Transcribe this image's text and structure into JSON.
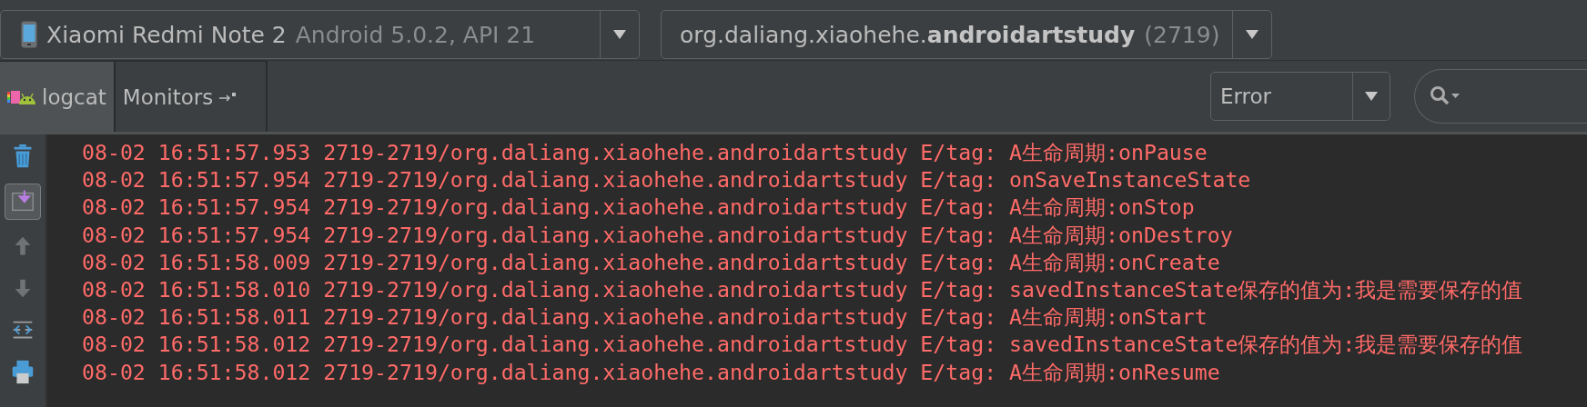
{
  "device_selector": {
    "name": "Xiaomi Redmi Note 2",
    "detail": "Android 5.0.2, API 21"
  },
  "process_selector": {
    "name": "org.daliang.xiaohehe.**androidartstudy**",
    "pid": "(2719)"
  },
  "tabs": [
    {
      "label": "logcat",
      "selected": true,
      "kind": "logcat"
    },
    {
      "label": "Monitors",
      "selected": false,
      "kind": "monitors"
    }
  ],
  "level_filter": {
    "value": "Error"
  },
  "tools": [
    {
      "kind": "clear",
      "selected": false
    },
    {
      "kind": "scroll_end",
      "selected": true
    },
    {
      "kind": "up",
      "selected": false
    },
    {
      "kind": "down",
      "selected": false
    },
    {
      "kind": "wrap",
      "selected": false
    },
    {
      "kind": "print",
      "selected": false
    }
  ],
  "log": [
    {
      "kind": "error",
      "text": "08-02 16:51:57.953 2719-2719/org.daliang.xiaohehe.androidartstudy E/tag: A生命周期:onPause"
    },
    {
      "kind": "error",
      "text": "08-02 16:51:57.954 2719-2719/org.daliang.xiaohehe.androidartstudy E/tag: onSaveInstanceState"
    },
    {
      "kind": "error",
      "text": "08-02 16:51:57.954 2719-2719/org.daliang.xiaohehe.androidartstudy E/tag: A生命周期:onStop"
    },
    {
      "kind": "error",
      "text": "08-02 16:51:57.954 2719-2719/org.daliang.xiaohehe.androidartstudy E/tag: A生命周期:onDestroy"
    },
    {
      "kind": "error",
      "text": "08-02 16:51:58.009 2719-2719/org.daliang.xiaohehe.androidartstudy E/tag: A生命周期:onCreate"
    },
    {
      "kind": "error",
      "text": "08-02 16:51:58.010 2719-2719/org.daliang.xiaohehe.androidartstudy E/tag: savedInstanceState保存的值为:我是需要保存的值"
    },
    {
      "kind": "error",
      "text": "08-02 16:51:58.011 2719-2719/org.daliang.xiaohehe.androidartstudy E/tag: A生命周期:onStart"
    },
    {
      "kind": "error",
      "text": "08-02 16:51:58.012 2719-2719/org.daliang.xiaohehe.androidartstudy E/tag: savedInstanceState保存的值为:我是需要保存的值"
    },
    {
      "kind": "error",
      "text": "08-02 16:51:58.012 2719-2719/org.daliang.xiaohehe.androidartstudy E/tag: A生命周期:onResume"
    }
  ]
}
